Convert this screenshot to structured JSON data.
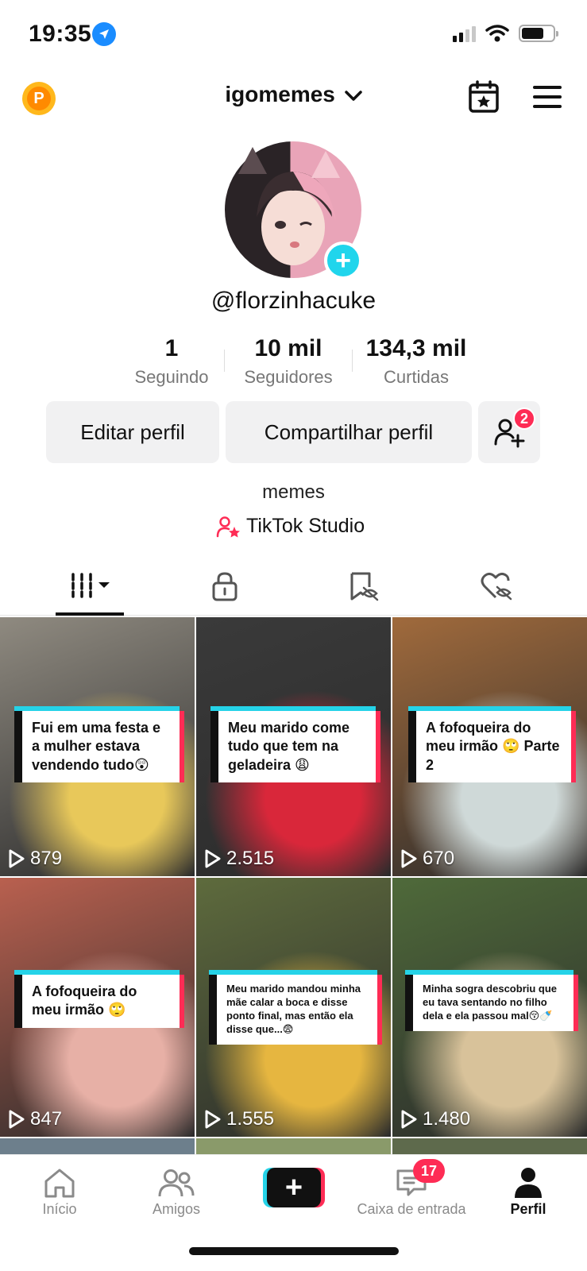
{
  "status_bar": {
    "time": "19:35"
  },
  "header": {
    "title": "igomemes",
    "coin_label": "P"
  },
  "profile": {
    "handle": "@florzinhacuke",
    "bio": "memes",
    "studio_link": "TikTok Studio",
    "stats": [
      {
        "value": "1",
        "label": "Seguindo"
      },
      {
        "value": "10 mil",
        "label": "Seguidores"
      },
      {
        "value": "134,3 mil",
        "label": "Curtidas"
      }
    ],
    "buttons": {
      "edit": "Editar perfil",
      "share": "Compartilhar perfil",
      "friend_badge": "2"
    }
  },
  "videos": [
    {
      "caption": "Fui em uma festa e a mulher estava vendendo tudo😲",
      "views": "879",
      "bg": "#8f8a80",
      "accent": "#e8c85a"
    },
    {
      "caption": "Meu marido come tudo que tem na geladeira 😩",
      "views": "2.515",
      "bg": "#3a3a3a",
      "accent": "#d9273a"
    },
    {
      "caption": "A fofoqueira do meu irmão 🙄 Parte 2",
      "views": "670",
      "bg": "#a06a3c",
      "accent": "#cfd9d8"
    },
    {
      "caption": "A fofoqueira do meu irmão 🙄",
      "views": "847",
      "bg": "#b9604f",
      "accent": "#e7b0a6"
    },
    {
      "caption": "Meu marido mandou minha mãe calar a boca e disse ponto final, mas então ela disse que...😨",
      "views": "1.555",
      "bg": "#5e6b3d",
      "accent": "#e6b640"
    },
    {
      "caption": "Minha sogra descobriu que eu tava sentando no filho dela e ela passou mal😚🍼",
      "views": "1.480",
      "bg": "#4f6a3a",
      "accent": "#d8c29a"
    }
  ],
  "nav": {
    "home": "Início",
    "friends": "Amigos",
    "inbox": "Caixa de entrada",
    "inbox_badge": "17",
    "profile": "Perfil"
  },
  "colors": {
    "accent_pink": "#fe2c55",
    "accent_cyan": "#25d3e8",
    "avatar_plus": "#20d5ec"
  }
}
